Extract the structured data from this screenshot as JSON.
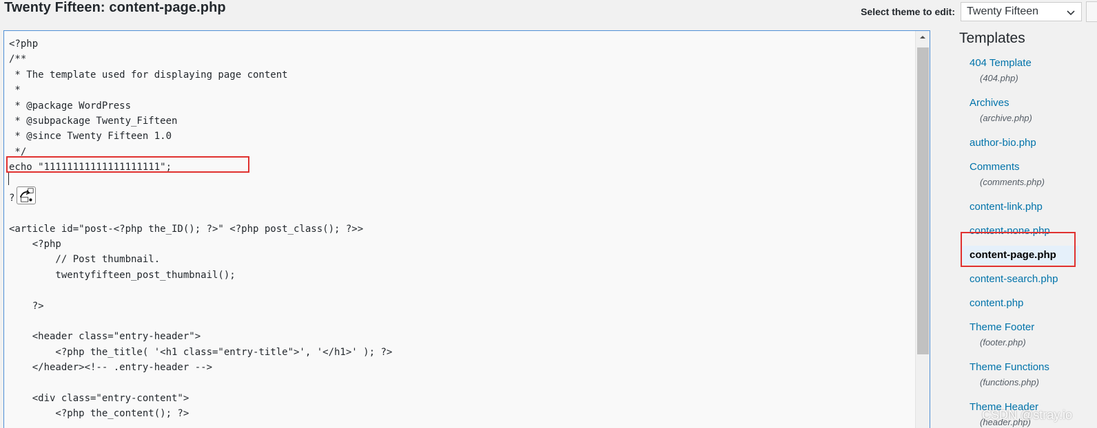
{
  "header": {
    "title": "Twenty Fifteen: content-page.php",
    "select_label": "Select theme to edit:",
    "selected_theme": "Twenty Fifteen"
  },
  "editor": {
    "lines": [
      "<?php",
      "/**",
      " * The template used for displaying page content",
      " *",
      " * @package WordPress",
      " * @subpackage Twenty_Fifteen",
      " * @since Twenty Fifteen 1.0",
      " */",
      "echo \"11111111111111111111\";",
      "",
      "?",
      "",
      "<article id=\"post-<?php the_ID(); ?>\" <?php post_class(); ?>>",
      "    <?php",
      "        // Post thumbnail.",
      "        twentyfifteen_post_thumbnail();",
      "",
      "    ?>",
      "",
      "    <header class=\"entry-header\">",
      "        <?php the_title( '<h1 class=\"entry-title\">', '</h1>' ); ?>",
      "    </header><!-- .entry-header -->",
      "",
      "    <div class=\"entry-content\">",
      "        <?php the_content(); ?>"
    ]
  },
  "sidebar": {
    "heading": "Templates",
    "items": [
      {
        "name": "404 Template",
        "file": "(404.php)"
      },
      {
        "name": "Archives",
        "file": "(archive.php)"
      },
      {
        "name": "author-bio.php",
        "file": ""
      },
      {
        "name": "Comments",
        "file": "(comments.php)"
      },
      {
        "name": "content-link.php",
        "file": ""
      },
      {
        "name": "content-none.php",
        "file": ""
      },
      {
        "name": "content-page.php",
        "file": "",
        "current": true
      },
      {
        "name": "content-search.php",
        "file": ""
      },
      {
        "name": "content.php",
        "file": ""
      },
      {
        "name": "Theme Footer",
        "file": "(footer.php)"
      },
      {
        "name": "Theme Functions",
        "file": "(functions.php)"
      },
      {
        "name": "Theme Header",
        "file": "(header.php)"
      }
    ]
  },
  "watermark": "CSDN @stray.io",
  "colors": {
    "link": "#0073aa",
    "highlight_box": "#e0312f",
    "current_bg": "#e5f0fa"
  }
}
